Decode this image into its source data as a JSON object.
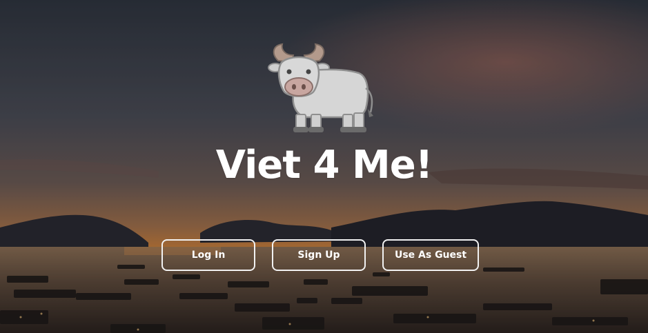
{
  "app": {
    "title": "Viet 4 Me!"
  },
  "mascot": {
    "icon": "water-buffalo-icon"
  },
  "actions": {
    "login_label": "Log In",
    "signup_label": "Sign Up",
    "guest_label": "Use As Guest"
  },
  "colors": {
    "button_border": "#f2f2f2",
    "text": "#ffffff"
  }
}
